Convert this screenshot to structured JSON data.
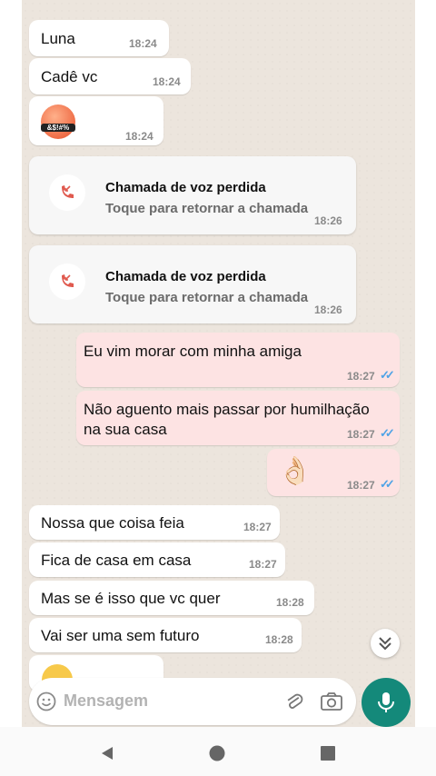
{
  "messages": [
    {
      "text": "Luna",
      "time": "18:24"
    },
    {
      "text": "Cadê vc",
      "time": "18:24"
    },
    {
      "emoji_label": "&$!#%",
      "time": "18:24"
    },
    {
      "call_title": "Chamada de voz perdida",
      "call_sub": "Toque para retornar a chamada",
      "time": "18:26"
    },
    {
      "call_title": "Chamada de voz perdida",
      "call_sub": "Toque para retornar a chamada",
      "time": "18:26"
    },
    {
      "text": "Eu vim morar com minha amiga",
      "time": "18:27"
    },
    {
      "text_line1": "Não aguento mais passar por humilhação",
      "text_line2": "na sua casa",
      "time": "18:27"
    },
    {
      "emoji": "👌🏻",
      "time": "18:27"
    },
    {
      "text": "Nossa que coisa feia",
      "time": "18:27"
    },
    {
      "text": "Fica de casa em casa",
      "time": "18:27"
    },
    {
      "text": "Mas se é isso que vc quer",
      "time": "18:28"
    },
    {
      "text": "Vai ser uma sem futuro",
      "time": "18:28"
    }
  ],
  "composer": {
    "placeholder": "Mensagem"
  },
  "icons": {
    "missed_call": "missed-call-icon",
    "emoji": "emoji-icon",
    "attach": "paperclip-icon",
    "camera": "camera-icon",
    "mic": "microphone-icon",
    "scroll": "chevron-double-down-icon"
  },
  "colors": {
    "incoming": "#ffffff",
    "outgoing": "#fde3e3",
    "accent": "#14897a",
    "ticks": "#4fa3e6",
    "missed": "#e05a4f"
  }
}
